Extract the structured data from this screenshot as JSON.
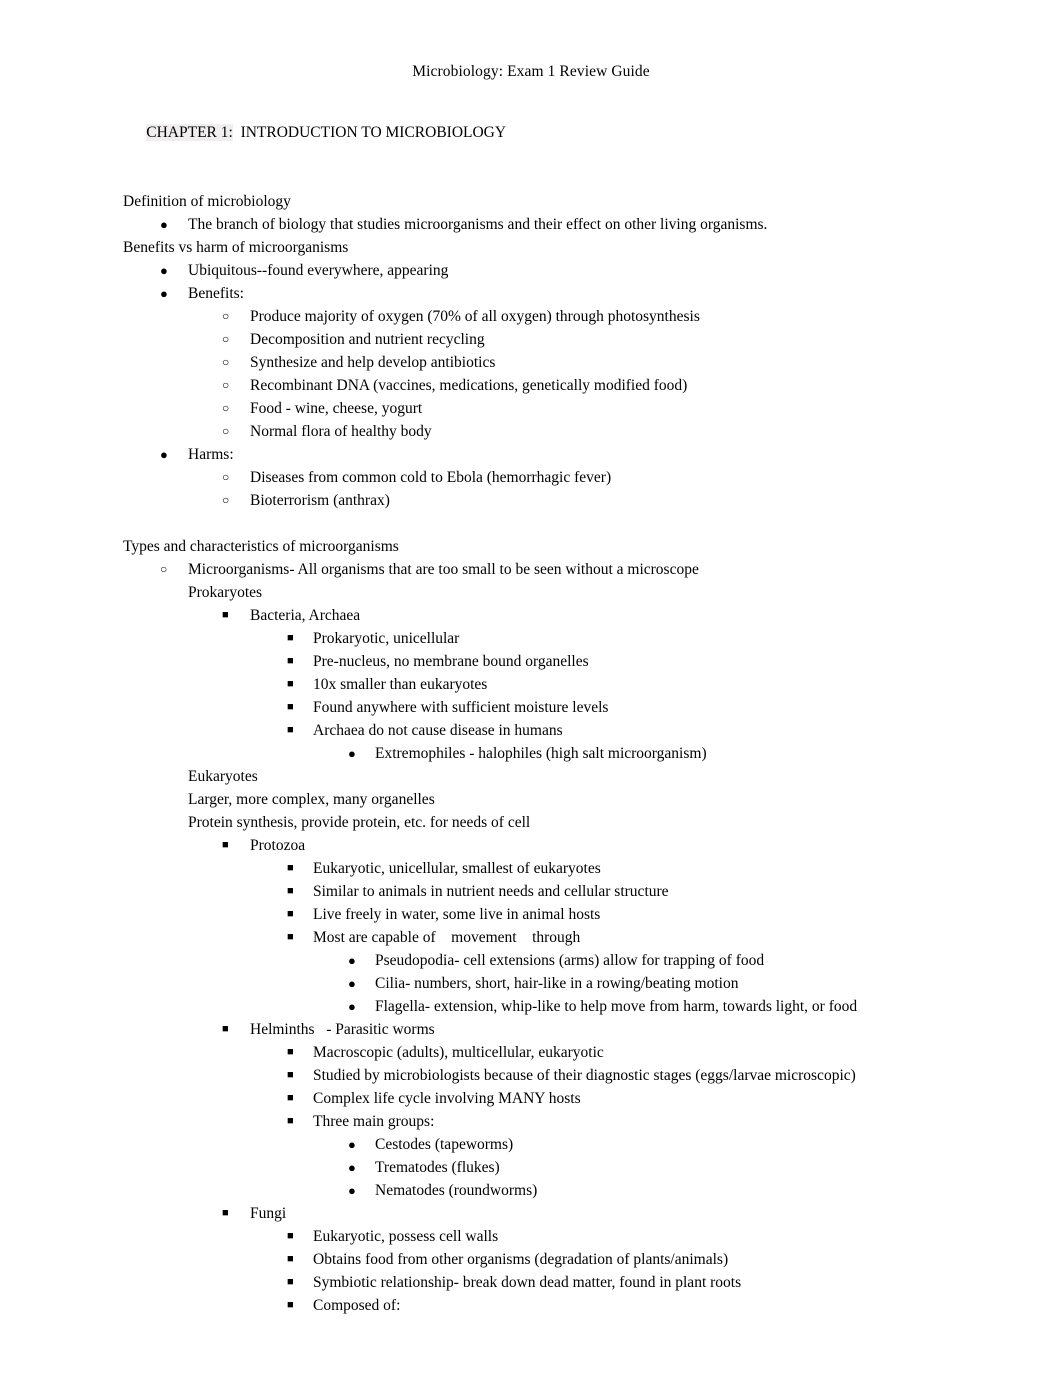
{
  "document": {
    "title": "Microbiology: Exam 1 Review Guide",
    "chapter_heading_highlight": "CHAPTER 1:",
    "chapter_heading_rest": "  INTRODUCTION TO MICROBIOLOGY",
    "highlight_color": "#f0eeee",
    "text_color": "#000000",
    "background_color": "#ffffff"
  },
  "markers": {
    "disc": "●",
    "circle": "○",
    "square": "■"
  },
  "body": {
    "lines": [
      {
        "kind": "plain",
        "level": 0,
        "text": "Definition of microbiology"
      },
      {
        "kind": "bullet",
        "level": 1,
        "marker": "disc",
        "text": "The branch of biology that studies microorganisms and their effect on other living organisms."
      },
      {
        "kind": "plain",
        "level": 0,
        "text": "Benefits vs harm of microorganisms"
      },
      {
        "kind": "bullet",
        "level": 1,
        "marker": "disc",
        "text": "Ubiquitous--found everywhere, appearing"
      },
      {
        "kind": "bullet",
        "level": 1,
        "marker": "disc",
        "text": "Benefits:"
      },
      {
        "kind": "bullet",
        "level": 2,
        "marker": "circle",
        "text": "Produce majority of oxygen (70% of all oxygen) through photosynthesis"
      },
      {
        "kind": "bullet",
        "level": 2,
        "marker": "circle",
        "text": "Decomposition and nutrient recycling"
      },
      {
        "kind": "bullet",
        "level": 2,
        "marker": "circle",
        "text": "Synthesize and help develop antibiotics"
      },
      {
        "kind": "bullet",
        "level": 2,
        "marker": "circle",
        "text": "Recombinant DNA (vaccines, medications, genetically modified food)"
      },
      {
        "kind": "bullet",
        "level": 2,
        "marker": "circle",
        "text": "Food - wine, cheese, yogurt"
      },
      {
        "kind": "bullet",
        "level": 2,
        "marker": "circle",
        "text": "Normal flora of healthy body"
      },
      {
        "kind": "bullet",
        "level": 1,
        "marker": "disc",
        "text": "Harms:"
      },
      {
        "kind": "bullet",
        "level": 2,
        "marker": "circle",
        "text": "Diseases from common cold to Ebola (hemorrhagic fever)"
      },
      {
        "kind": "bullet",
        "level": 2,
        "marker": "circle",
        "text": "Bioterrorism (anthrax)"
      },
      {
        "kind": "spacer"
      },
      {
        "kind": "plain",
        "level": 0,
        "text": "Types and characteristics of microorganisms"
      },
      {
        "kind": "bullet",
        "level": 1,
        "marker": "circle",
        "text": "Microorganisms- All organisms that are too small to be seen without a microscope"
      },
      {
        "kind": "plain",
        "level": 1,
        "text": "Prokaryotes"
      },
      {
        "kind": "bullet",
        "level": 3,
        "marker": "square",
        "text": "Bacteria, Archaea"
      },
      {
        "kind": "bullet",
        "level": 4,
        "marker": "square",
        "text": "Prokaryotic, unicellular"
      },
      {
        "kind": "bullet",
        "level": 4,
        "marker": "square",
        "text": "Pre-nucleus, no membrane bound organelles"
      },
      {
        "kind": "bullet",
        "level": 4,
        "marker": "square",
        "text": "10x smaller than eukaryotes"
      },
      {
        "kind": "bullet",
        "level": 4,
        "marker": "square",
        "text": "Found anywhere with sufficient moisture levels"
      },
      {
        "kind": "bullet",
        "level": 4,
        "marker": "square",
        "text": "Archaea do not cause disease in humans"
      },
      {
        "kind": "bullet",
        "level": 5,
        "marker": "disc",
        "text": "Extremophiles - halophiles (high salt microorganism)"
      },
      {
        "kind": "plain",
        "level": 1,
        "text": "Eukaryotes"
      },
      {
        "kind": "plain",
        "level": 1,
        "text": "Larger, more complex, many organelles"
      },
      {
        "kind": "plain",
        "level": 1,
        "text": "Protein synthesis, provide protein, etc. for needs of cell"
      },
      {
        "kind": "bullet",
        "level": 3,
        "marker": "square",
        "text": "Protozoa"
      },
      {
        "kind": "bullet",
        "level": 4,
        "marker": "square",
        "text": "Eukaryotic, unicellular, smallest of eukaryotes"
      },
      {
        "kind": "bullet",
        "level": 4,
        "marker": "square",
        "text": "Similar to animals in nutrient needs and cellular structure"
      },
      {
        "kind": "bullet",
        "level": 4,
        "marker": "square",
        "text": "Live freely in water, some live in animal hosts"
      },
      {
        "kind": "bullet",
        "level": 4,
        "marker": "square",
        "text": "Most are capable of    movement    through"
      },
      {
        "kind": "bullet",
        "level": 5,
        "marker": "disc",
        "text": "Pseudopodia- cell extensions (arms) allow for trapping of food"
      },
      {
        "kind": "bullet",
        "level": 5,
        "marker": "disc",
        "text": "Cilia- numbers, short, hair-like in a rowing/beating motion"
      },
      {
        "kind": "bullet",
        "level": 5,
        "marker": "disc",
        "text": "Flagella- extension, whip-like to help move from harm, towards light, or food"
      },
      {
        "kind": "bullet",
        "level": 3,
        "marker": "square",
        "text": "Helminths   - Parasitic worms"
      },
      {
        "kind": "bullet",
        "level": 4,
        "marker": "square",
        "text": "Macroscopic (adults), multicellular, eukaryotic"
      },
      {
        "kind": "bullet",
        "level": 4,
        "marker": "square",
        "text": "Studied by microbiologists because of their diagnostic stages (eggs/larvae microscopic)"
      },
      {
        "kind": "bullet",
        "level": 4,
        "marker": "square",
        "text": "Complex life cycle involving MANY hosts"
      },
      {
        "kind": "bullet",
        "level": 4,
        "marker": "square",
        "text": "Three main groups:"
      },
      {
        "kind": "bullet",
        "level": 5,
        "marker": "disc",
        "text": "Cestodes (tapeworms)"
      },
      {
        "kind": "bullet",
        "level": 5,
        "marker": "disc",
        "text": "Trematodes (flukes)"
      },
      {
        "kind": "bullet",
        "level": 5,
        "marker": "disc",
        "text": "Nematodes (roundworms)"
      },
      {
        "kind": "bullet",
        "level": 3,
        "marker": "square",
        "text": "Fungi"
      },
      {
        "kind": "bullet",
        "level": 4,
        "marker": "square",
        "text": "Eukaryotic, possess cell walls"
      },
      {
        "kind": "bullet",
        "level": 4,
        "marker": "square",
        "text": "Obtains food from other organisms (degradation of plants/animals)"
      },
      {
        "kind": "bullet",
        "level": 4,
        "marker": "square",
        "text": "Symbiotic relationship- break down dead matter, found in plant roots"
      },
      {
        "kind": "bullet",
        "level": 4,
        "marker": "square",
        "text": "Composed of:"
      }
    ]
  }
}
